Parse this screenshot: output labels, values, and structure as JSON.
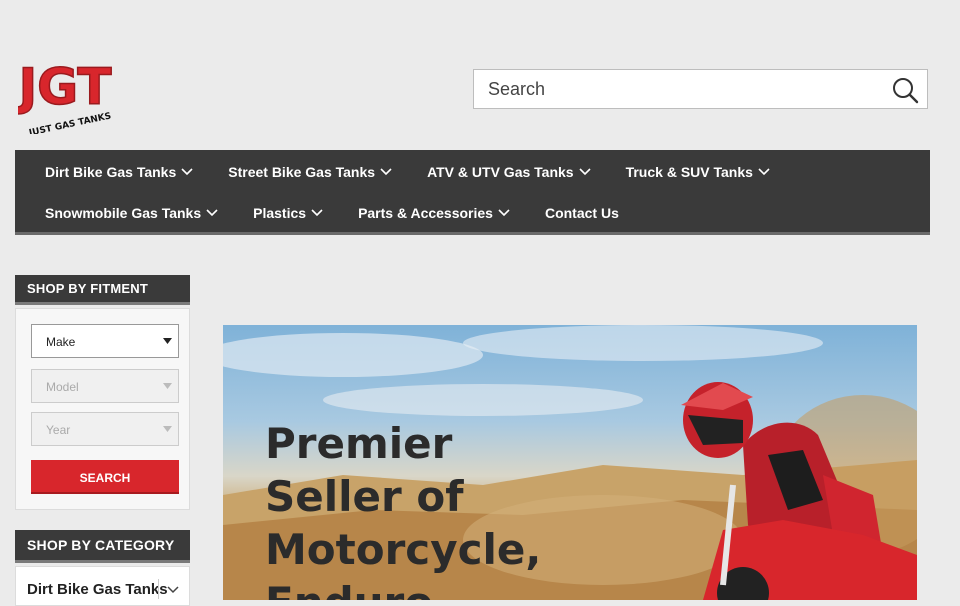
{
  "brand": {
    "logo_text": "JGT",
    "logo_tagline": "JUST GAS TANKS"
  },
  "search": {
    "placeholder": "Search"
  },
  "nav": {
    "row1": [
      {
        "label": "Dirt Bike Gas Tanks",
        "has_dropdown": true
      },
      {
        "label": "Street Bike Gas Tanks",
        "has_dropdown": true
      },
      {
        "label": "ATV & UTV Gas Tanks",
        "has_dropdown": true
      },
      {
        "label": "Truck & SUV Tanks",
        "has_dropdown": true
      }
    ],
    "row2": [
      {
        "label": "Snowmobile Gas Tanks",
        "has_dropdown": true
      },
      {
        "label": "Plastics",
        "has_dropdown": true
      },
      {
        "label": "Parts & Accessories",
        "has_dropdown": true
      },
      {
        "label": "Contact Us",
        "has_dropdown": false
      }
    ]
  },
  "fitment": {
    "heading": "SHOP BY FITMENT",
    "make": "Make",
    "model": "Model",
    "year": "Year",
    "button": "SEARCH"
  },
  "category": {
    "heading": "SHOP BY CATEGORY",
    "items": [
      "Dirt Bike Gas Tanks"
    ]
  },
  "hero": {
    "title_lines": [
      "Premier",
      "Seller of",
      "Motorcycle,",
      "Enduro"
    ]
  },
  "colors": {
    "accent": "#d8262c",
    "nav_bg": "#3a3a3a",
    "page_bg": "#ebebeb"
  }
}
